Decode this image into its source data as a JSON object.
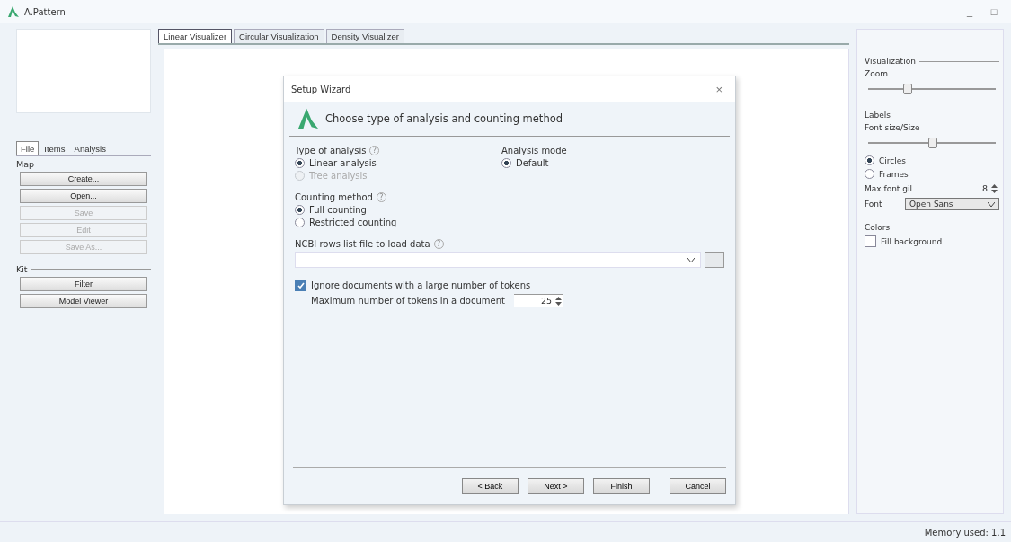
{
  "window": {
    "title": "A.Pattern",
    "controls": [
      "_",
      "□"
    ]
  },
  "left_tabs": [
    {
      "label": "File",
      "selected": true
    },
    {
      "label": "Items",
      "selected": false
    },
    {
      "label": "Analysis",
      "selected": false
    }
  ],
  "map_group": {
    "label": "Map",
    "buttons": [
      {
        "label": "Create...",
        "disabled": false
      },
      {
        "label": "Open...",
        "disabled": false
      },
      {
        "label": "Save",
        "disabled": true
      },
      {
        "label": "Edit",
        "disabled": true
      },
      {
        "label": "Save As...",
        "disabled": true
      }
    ]
  },
  "kit_group": {
    "label": "Kit",
    "buttons": [
      {
        "label": "Filter",
        "disabled": false
      },
      {
        "label": "Model Viewer",
        "disabled": false
      }
    ]
  },
  "view_tabs": [
    {
      "label": "Linear Visualizer",
      "selected": true
    },
    {
      "label": "Circular Visualization",
      "selected": false
    },
    {
      "label": "Density Visualizer",
      "selected": false
    }
  ],
  "dialog": {
    "title": "Setup Wizard",
    "close": "×",
    "heading": "Choose type of analysis and counting method",
    "analysis": {
      "label": "Type of analysis",
      "help": "?",
      "options": [
        {
          "label": "Linear analysis",
          "selected": true,
          "disabled": false
        },
        {
          "label": "Tree analysis",
          "selected": false,
          "disabled": true
        }
      ]
    },
    "mode": {
      "label": "Analysis mode",
      "options": [
        {
          "label": "Default",
          "selected": true,
          "disabled": false
        }
      ]
    },
    "counting": {
      "label": "Counting method",
      "help": "?",
      "options": [
        {
          "label": "Full counting",
          "selected": true,
          "disabled": false
        },
        {
          "label": "Restricted counting",
          "selected": false,
          "disabled": false
        }
      ]
    },
    "file": {
      "label": "NCBI rows list file to load data",
      "help": "?",
      "browse": "..."
    },
    "ignore": {
      "label": "Ignore documents with a large number of tokens",
      "checked": true
    },
    "max_tokens": {
      "label": "Maximum number of tokens in a document",
      "value": "25"
    },
    "buttons": [
      "< Back",
      "Next >",
      "Finish",
      "Cancel"
    ]
  },
  "right_panel": {
    "visualization": "Visualization",
    "zoom": {
      "label": "Zoom",
      "level": 0.3
    },
    "labels": "Labels",
    "font_size": {
      "label": "Font size/Size",
      "level": 0.5
    },
    "shapes": [
      {
        "label": "Circles",
        "selected": true
      },
      {
        "label": "Frames",
        "selected": false
      }
    ],
    "max_font": {
      "label": "Max font gil",
      "value": "8"
    },
    "font": {
      "label": "Font",
      "value": "Open Sans"
    },
    "colors": "Colors",
    "fill": {
      "label": "Fill background",
      "checked": false
    }
  },
  "status_bar": {
    "text": "Memory used: 1.1"
  }
}
